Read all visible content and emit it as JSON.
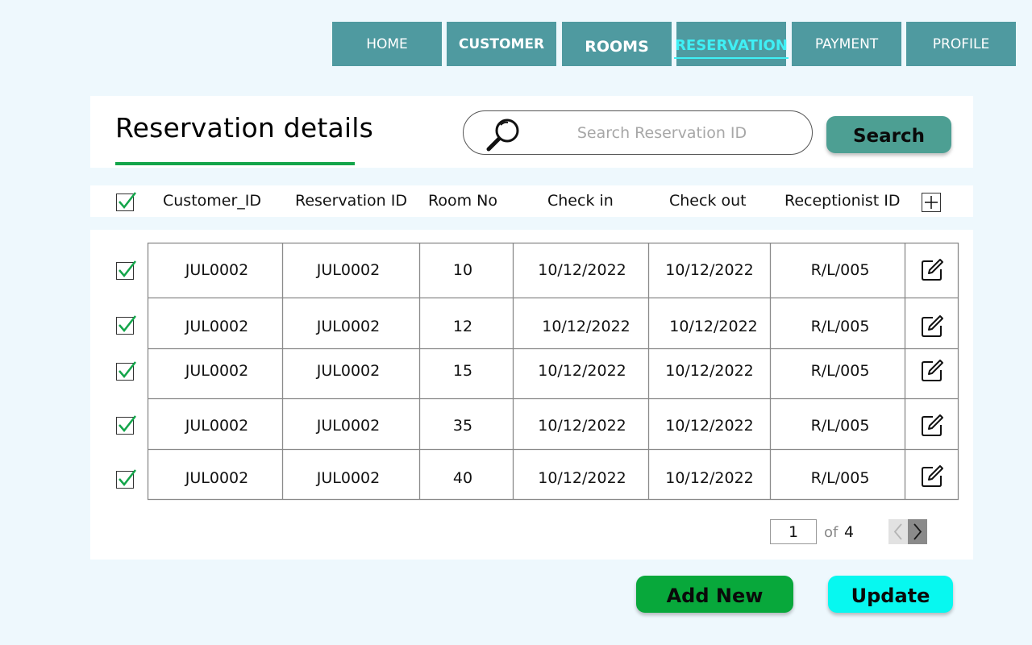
{
  "nav": {
    "tabs": [
      {
        "label": "HOME"
      },
      {
        "label": "CUSTOMER"
      },
      {
        "label": "ROOMS"
      },
      {
        "label": "RESERVATION"
      },
      {
        "label": "PAYMENT"
      },
      {
        "label": "PROFILE"
      }
    ],
    "active": "RESERVATION"
  },
  "header": {
    "title": "Reservation details",
    "search_placeholder": "Search Reservation ID",
    "search_button": "Search"
  },
  "table": {
    "columns": [
      "Customer_ID",
      "Reservation ID",
      "Room No",
      "Check in",
      "Check out",
      "Receptionist ID"
    ],
    "rows": [
      {
        "customer_id": "JUL0002",
        "reservation_id": "JUL0002",
        "room_no": "10",
        "check_in": "10/12/2022",
        "check_out": "10/12/2022",
        "receptionist_id": "R/L/005"
      },
      {
        "customer_id": "JUL0002",
        "reservation_id": "JUL0002",
        "room_no": "12",
        "check_in": "10/12/2022",
        "check_out": "10/12/2022",
        "receptionist_id": "R/L/005"
      },
      {
        "customer_id": "JUL0002",
        "reservation_id": "JUL0002",
        "room_no": "15",
        "check_in": "10/12/2022",
        "check_out": "10/12/2022",
        "receptionist_id": "R/L/005"
      },
      {
        "customer_id": "JUL0002",
        "reservation_id": "JUL0002",
        "room_no": "35",
        "check_in": "10/12/2022",
        "check_out": "10/12/2022",
        "receptionist_id": "R/L/005"
      },
      {
        "customer_id": "JUL0002",
        "reservation_id": "JUL0002",
        "room_no": "40",
        "check_in": "10/12/2022",
        "check_out": "10/12/2022",
        "receptionist_id": "R/L/005"
      }
    ]
  },
  "pager": {
    "current": "1",
    "of_label": "of",
    "total": "4"
  },
  "actions": {
    "add_new": "Add New",
    "update": "Update"
  },
  "colors": {
    "background": "#eef8fd",
    "nav_tab": "#4f9aa0",
    "nav_active_text": "#3ff0f5",
    "title_underline": "#13a54a",
    "search_button": "#4d9f93",
    "add_button": "#08a83b",
    "update_button": "#07f8f0",
    "check_mark": "#13a54a"
  }
}
